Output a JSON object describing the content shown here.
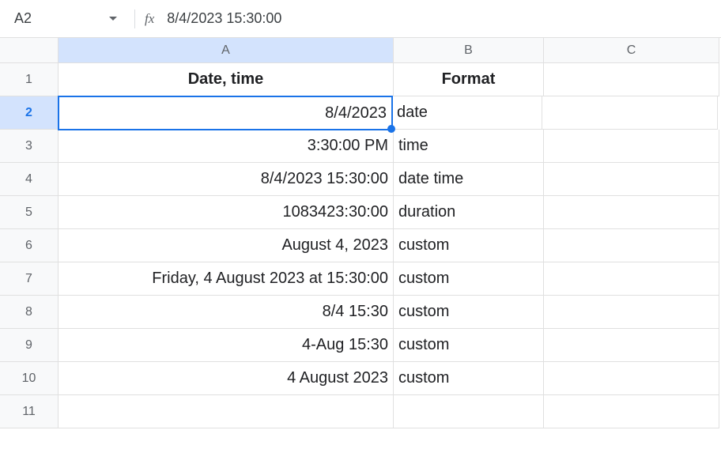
{
  "formula_bar": {
    "name_box": "A2",
    "fx_label": "fx",
    "formula": "8/4/2023 15:30:00"
  },
  "columns": {
    "a": "A",
    "b": "B",
    "c": "C"
  },
  "rows": {
    "r1": "1",
    "r2": "2",
    "r3": "3",
    "r4": "4",
    "r5": "5",
    "r6": "6",
    "r7": "7",
    "r8": "8",
    "r9": "9",
    "r10": "10",
    "r11": "11"
  },
  "headers": {
    "col_a": "Date, time",
    "col_b": "Format"
  },
  "data": {
    "a2": "8/4/2023",
    "b2": "date",
    "a3": "3:30:00 PM",
    "b3": "time",
    "a4": "8/4/2023 15:30:00",
    "b4": "date time",
    "a5": "1083423:30:00",
    "b5": "duration",
    "a6": "August 4, 2023",
    "b6": "custom",
    "a7": "Friday, 4 August 2023 at 15:30:00",
    "b7": "custom",
    "a8": "8/4 15:30",
    "b8": "custom",
    "a9": "4-Aug 15:30",
    "b9": "custom",
    "a10": "4 August 2023",
    "b10": "custom"
  }
}
